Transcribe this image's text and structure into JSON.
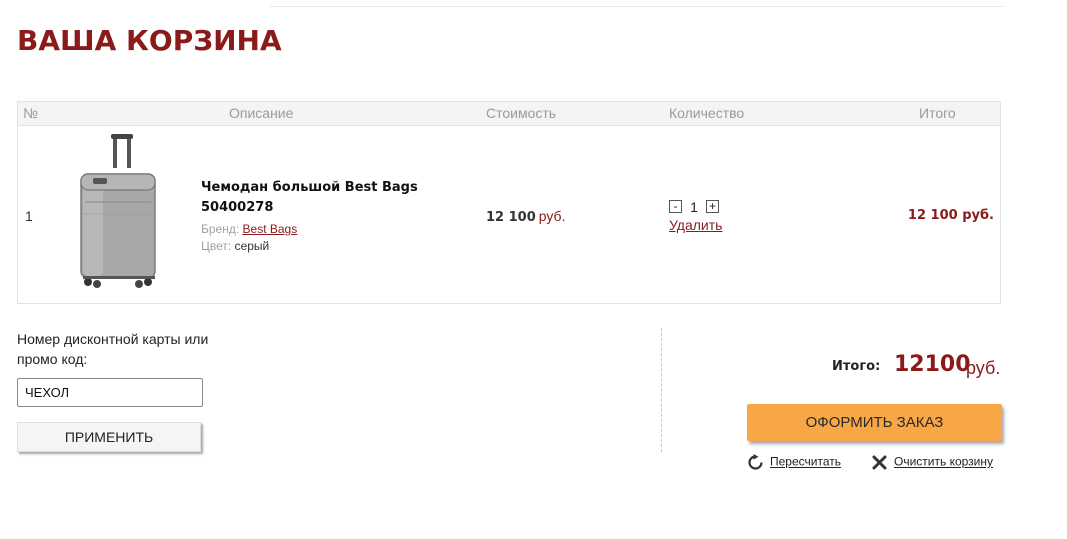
{
  "page": {
    "title": "ВАША КОРЗИНА"
  },
  "table": {
    "headers": [
      "№",
      "Описание",
      "Стоимость",
      "Количество",
      "Итого"
    ],
    "rows": [
      {
        "num": "1",
        "name": "Чемодан большой Best Bags 50400278",
        "brand_label": "Бренд:",
        "brand": "Best Bags",
        "color_label": "Цвет:",
        "color": "серый",
        "price": "12 100",
        "price_currency": "руб.",
        "qty_minus": "-",
        "qty": "1",
        "qty_plus": "+",
        "delete_label": "Удалить",
        "total": "12 100 руб."
      }
    ]
  },
  "promo": {
    "label": "Номер дисконтной карты или промо код:",
    "value": "ЧЕХОЛ",
    "apply_label": "ПРИМЕНИТЬ"
  },
  "summary": {
    "total_label": "Итого:",
    "total_value": "12100",
    "total_currency": "руб.",
    "checkout_label": "ОФОРМИТЬ ЗАКАЗ",
    "recalc_label": "Пересчитать",
    "clear_label": "Очистить корзину"
  },
  "colors": {
    "accent": "#8b1a1a",
    "checkout": "#f7a746"
  },
  "icons": {
    "recalc": "refresh-icon",
    "clear": "close-icon",
    "product": "suitcase-image"
  }
}
